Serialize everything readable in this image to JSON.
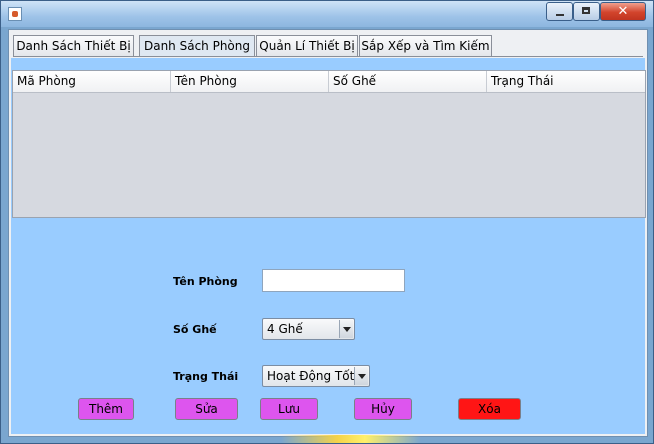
{
  "window": {
    "title": ""
  },
  "tabs": [
    {
      "label": "Danh Sách Thiết Bị",
      "selected": false
    },
    {
      "label": "Danh Sách Phòng",
      "selected": true
    },
    {
      "label": "Quản Lí Thiết Bị",
      "selected": false
    },
    {
      "label": "Sắp Xếp và Tìm Kiếm",
      "selected": false
    }
  ],
  "table": {
    "columns": [
      "Mã Phòng",
      "Tên Phòng",
      "Số Ghế",
      "Trạng Thái"
    ],
    "rows": []
  },
  "form": {
    "room_name_label": "Tên Phòng",
    "room_name_value": "",
    "seats_label": "Số Ghế",
    "seats_value": "4 Ghế",
    "status_label": "Trạng Thái",
    "status_value": "Hoạt Động Tốt"
  },
  "buttons": {
    "add": "Thêm",
    "edit": "Sửa",
    "save": "Lưu",
    "cancel": "Hủy",
    "delete": "Xóa"
  },
  "colors": {
    "content_bg": "#99ccff",
    "button_purple": "#dd55ee",
    "button_red": "#ff1515"
  },
  "icons": [
    "java-app-icon",
    "minimize-icon",
    "maximize-icon",
    "close-icon",
    "chevron-down-icon"
  ]
}
